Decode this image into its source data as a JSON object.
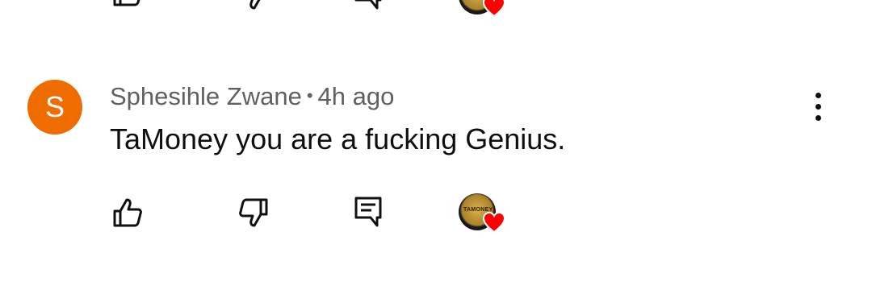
{
  "comment": {
    "author_initial": "S",
    "author": "Sphesihle Zwane",
    "separator": "•",
    "time": "4h ago",
    "text": "TaMoney you are a fucking Genius."
  },
  "creator_badge": {
    "avatar_text": "TAMONEY"
  },
  "icons": {
    "like": "thumbs-up-icon",
    "dislike": "thumbs-down-icon",
    "reply": "comment-reply-icon",
    "more": "more-vertical-icon",
    "heart": "creator-heart-icon"
  },
  "colors": {
    "avatar_bg": "#ef6c00",
    "meta_text": "#606060",
    "text": "#0f0f0f",
    "heart": "#ff0000"
  }
}
